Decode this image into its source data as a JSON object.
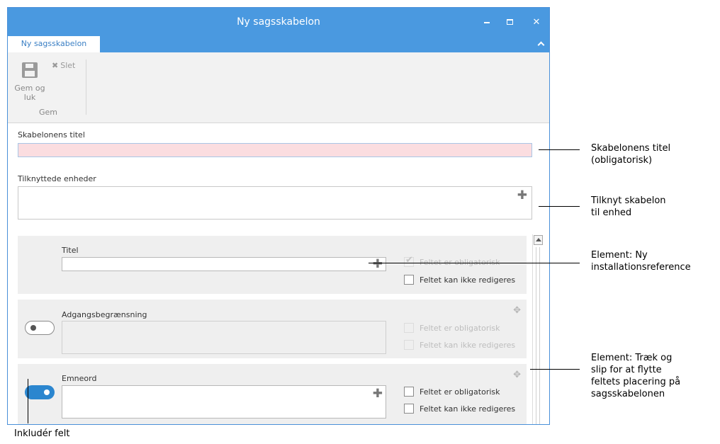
{
  "window": {
    "title": "Ny sagsskabelon"
  },
  "tab": {
    "label": "Ny sagsskabelon"
  },
  "ribbon": {
    "save_close_line1": "Gem og",
    "save_close_line2": "luk",
    "delete_label": "Slet",
    "group_label": "Gem"
  },
  "form": {
    "title_label": "Skabelonens titel",
    "title_value": "",
    "units_label": "Tilknyttede enheder"
  },
  "fields": [
    {
      "label": "Titel",
      "required_label": "Feltet er obligatorisk",
      "readonly_label": "Feltet kan ikke redigeres",
      "included": true,
      "required_checked": true,
      "required_disabled": true,
      "readonly_checked": false,
      "readonly_disabled": false
    },
    {
      "label": "Adgangsbegrænsning",
      "required_label": "Feltet er obligatorisk",
      "readonly_label": "Feltet kan ikke redigeres",
      "included": false,
      "required_checked": false,
      "required_disabled": true,
      "readonly_checked": false,
      "readonly_disabled": true
    },
    {
      "label": "Emneord",
      "required_label": "Feltet er obligatorisk",
      "readonly_label": "Feltet kan ikke redigeres",
      "included": true,
      "required_checked": false,
      "required_disabled": false,
      "readonly_checked": false,
      "readonly_disabled": false
    }
  ],
  "callouts": {
    "title_line1": "Skabelonens titel",
    "title_line2": "(obligatorisk)",
    "units_line1": "Tilknyt skabelon",
    "units_line2": "til enhed",
    "element_new_line1": "Element: Ny",
    "element_new_line2": "installationsreference",
    "drag_line1": "Element: Træk og",
    "drag_line2": "slip for at flytte",
    "drag_line3": "feltets placering på",
    "drag_line4": "sagsskabelonen",
    "include_field": "Inkludér felt"
  },
  "colors": {
    "titlebar": "#4a99e0",
    "required_field": "#fbdde0",
    "toggle_on": "#2b86cf"
  }
}
